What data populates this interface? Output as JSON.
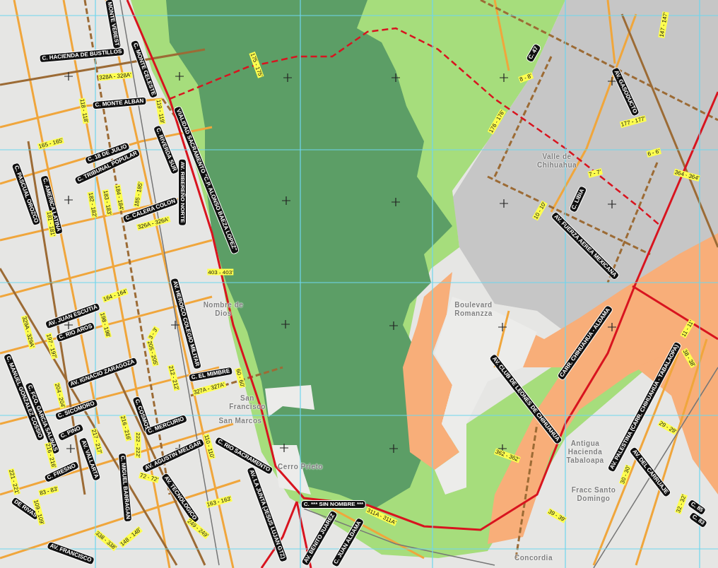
{
  "map": {
    "street_labels": [
      "C. HACIENDA DE BUSTILLOS",
      "MONTE VEREST",
      "C. MONTE CELESTE",
      "C. MONTE ALBAN",
      "VIALIDAD SACRAMENTO \"C.P. ALONSO BAEZA LOPEZ\"",
      "C. RIVERDA SUR",
      "AV. RIBEREÑO NORTE",
      "C. CALERA COLON",
      "C. 18 DE JULIO",
      "C. TRIBUNAL POPULAR",
      "C. PASCUAL OROZCO",
      "C. AMERICA LATINA",
      "AV. JUAN ESCUTIA",
      "C. RIO AROS",
      "AV. IGNACIO ZARAGOZA",
      "C. MANUEL GONZALEZ COSSIO",
      "C. FCO. GARCIA SALINAS",
      "C. SICOMORO",
      "C. PINO",
      "AV. VALLARTA",
      "C. FRESNO",
      "C. MIGUEL BARRAGAN",
      "C. COSMOS",
      "C. MERCURIO",
      "AV. AGUSTIN MELGAR",
      "AV. TECNOLOGICO",
      "AV. HEROICO COLEGIO MILITAR",
      "C. EL MIMBRE",
      "C. RIO SACRAMENTO",
      "C. *** SIN NOMBRE ***",
      "AV. LA JUNTA (JESUS LUJAN GTZ)",
      "AV. BENITO JUAREZ",
      "C. JUAN ALDAMA",
      "C. 47",
      "AV. GASODUCTO",
      "C. LIBIA",
      "AV. FUERZA AEREA MEXICANA",
      "CARR. CHIHUAHUA - ALDAMA",
      "AV. CLUB DE LEONES DE CHIHUAHUA",
      "AV. PALESTINA (CARR. CHIHUAHUA - TABALAOPA)",
      "AV. DEL CARRUAJE",
      "C. 85",
      "C. 83",
      "DE RIVAS",
      "AV. FRANCISCO"
    ],
    "segment_labels": [
      "328A - 328A'",
      "119 - 119'",
      "118 - 118'",
      "165 - 165'",
      "182 - 182'",
      "183 - 183'",
      "184 - 184'",
      "185 - 185'",
      "181 - 181'",
      "326A - 326A'",
      "403 - 403'",
      "175 - 175'",
      "176 - 176'",
      "8 - 8'",
      "147 - 147'",
      "177 - 177'",
      "6 - 6'",
      "7 - 7'",
      "10 - 10'",
      "364 - 364'",
      "11 - 11'",
      "38 - 38'",
      "29 - 29'",
      "30 - 30'",
      "39 - 39'",
      "362 - 362'",
      "32 - 32'",
      "164 - 164'",
      "3 - 3'",
      "198 - 198'",
      "197 - 197'",
      "329A - 329A'",
      "205 - 205'",
      "212 - 212'",
      "327A - 327A'",
      "204 - 204'",
      "216 - 216'",
      "217 - 217'",
      "222 - 222'",
      "216 - 216'",
      "110 - 110'",
      "72 - 72'",
      "83 - 83'",
      "221 - 221'",
      "109 - 109'",
      "249 - 249'",
      "338 - 338'",
      "148 - 148'",
      "311A - 311A'",
      "60 - 60'",
      "163 - 163'"
    ],
    "place_names": [
      "Nombre de Dios",
      "San Francisco",
      "San Marcos",
      "Cerro Prieto",
      "Antigua Hacienda Tabaloapa",
      "Fracc Santo Domingo",
      "Valle de Chihuahua",
      "Concordia",
      "Boulevard Romanzza"
    ]
  }
}
